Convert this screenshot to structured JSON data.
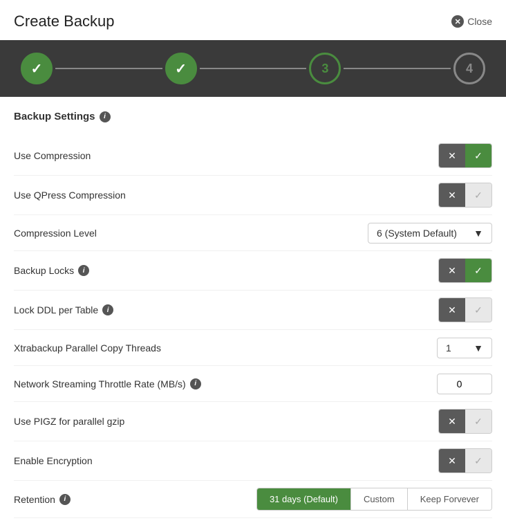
{
  "header": {
    "title": "Create Backup",
    "close_label": "Close"
  },
  "stepper": {
    "steps": [
      {
        "id": 1,
        "state": "done",
        "label": "✓"
      },
      {
        "id": 2,
        "state": "done",
        "label": "✓"
      },
      {
        "id": 3,
        "state": "active",
        "label": "3"
      },
      {
        "id": 4,
        "state": "inactive",
        "label": "4"
      }
    ]
  },
  "section": {
    "title": "Backup Settings"
  },
  "rows": [
    {
      "label": "Use Compression",
      "type": "toggle",
      "x_active": true,
      "check_active": true
    },
    {
      "label": "Use QPress Compression",
      "type": "toggle",
      "x_active": true,
      "check_active": false
    },
    {
      "label": "Compression Level",
      "type": "dropdown",
      "value": "6 (System Default)"
    },
    {
      "label": "Backup Locks",
      "type": "toggle",
      "has_info": true,
      "x_active": true,
      "check_active": true
    },
    {
      "label": "Lock DDL per Table",
      "type": "toggle",
      "has_info": true,
      "x_active": true,
      "check_active": false
    },
    {
      "label": "Xtrabackup Parallel Copy Threads",
      "type": "dropdown_small",
      "value": "1"
    },
    {
      "label": "Network Streaming Throttle Rate (MB/s)",
      "type": "number",
      "has_info": true,
      "value": "0"
    },
    {
      "label": "Use PIGZ for parallel gzip",
      "type": "toggle",
      "x_active": true,
      "check_active": false
    },
    {
      "label": "Enable Encryption",
      "type": "toggle",
      "x_active": true,
      "check_active": false
    },
    {
      "label": "Retention",
      "type": "retention",
      "has_info": true
    }
  ],
  "retention": {
    "tabs": [
      {
        "label": "31 days (Default)",
        "active": true
      },
      {
        "label": "Custom",
        "active": false
      },
      {
        "label": "Keep Forvever",
        "active": false
      }
    ]
  }
}
